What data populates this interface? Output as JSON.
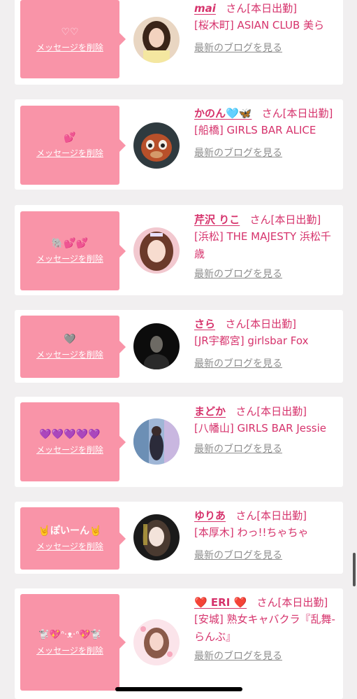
{
  "delete_label": "メッセージを削除",
  "blog_label": "最新のブログを見る",
  "cards": [
    {
      "message": "♡♡",
      "name": "mai",
      "san": "さん[本日出勤]",
      "shop": "[桜木町] ASIAN CLUB 美ら"
    },
    {
      "message": "💕",
      "name": "かのん🩵🦋",
      "san": "さん[本日出勤]",
      "shop": "[船橋] GIRLS BAR ALICE"
    },
    {
      "message": "🐘💕💕",
      "name": "芹沢 りこ",
      "san": "さん[本日出勤]",
      "shop": "[浜松] THE MAJESTY 浜松千歳"
    },
    {
      "message": "🩶",
      "name": "さら",
      "san": "さん[本日出勤]",
      "shop": "[JR宇都宮] girlsbar Fox"
    },
    {
      "message": "💜💜💜💜💜",
      "name": "まどか",
      "san": "さん[本日出勤]",
      "shop": "[八幡山] GIRLS BAR Jessie"
    },
    {
      "message": "🤘ぽいーん🤘",
      "name": "ゆりあ",
      "san": "さん[本日出勤]",
      "shop": "[本厚木] わっ!!ちゃちゃ"
    },
    {
      "message": "🐩💖ᐢ·ᴥ·ᐢ💖🐩",
      "name": "❤️ ERI ❤️",
      "san": "さん[本日出勤]",
      "shop": "[安城] 熟女キャバクラ『乱舞-らんぶ』"
    }
  ]
}
